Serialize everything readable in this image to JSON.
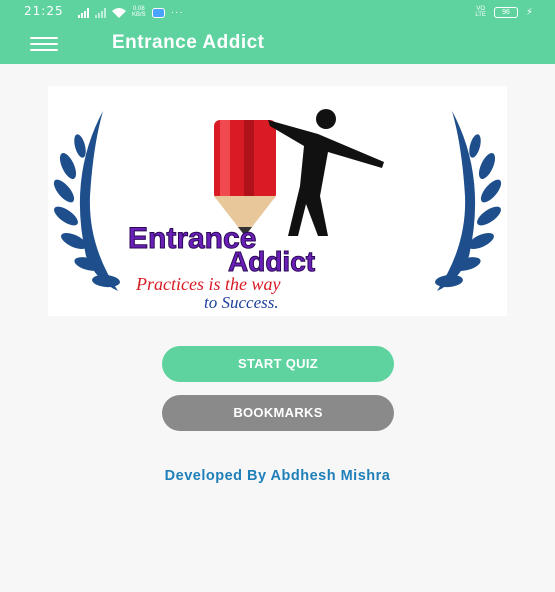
{
  "status_bar": {
    "time": "21:25",
    "net_speed": "0.08\nKB/S",
    "network_type": "VO\nLTE",
    "battery": "96",
    "overflow": "···"
  },
  "app_bar": {
    "title": "Entrance Addict",
    "menu_icon": "hamburger-icon"
  },
  "logo": {
    "line1": "Entrance",
    "line2": "Addict",
    "tagline1": "Practices is the way",
    "tagline2": "to Success."
  },
  "buttons": {
    "start_quiz": "START QUIZ",
    "bookmarks": "BOOKMARKS"
  },
  "footer": {
    "developer": "Developed By Abdhesh Mishra"
  },
  "colors": {
    "primary": "#5ed3a0",
    "secondary_button": "#8a8a8a",
    "developer_text": "#1f7fb8",
    "background": "#f7f7f7"
  }
}
